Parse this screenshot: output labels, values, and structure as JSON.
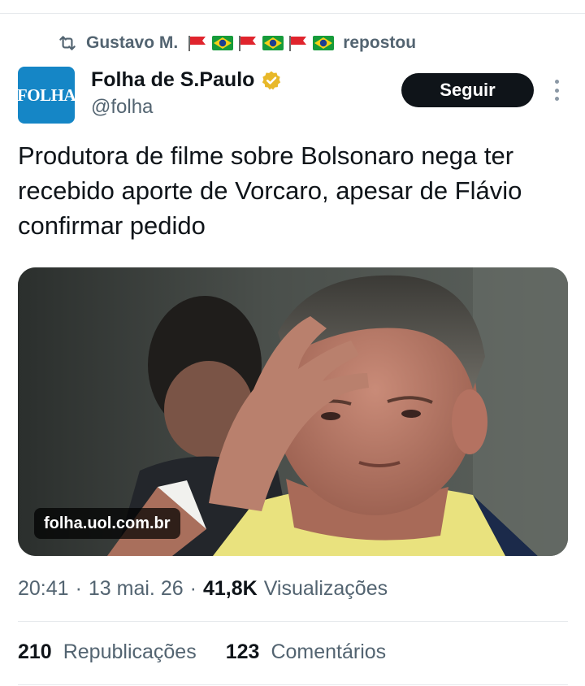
{
  "repost": {
    "icon": "repost-icon",
    "user_name": "Gustavo M.",
    "flags": [
      "red-flag",
      "brazil-flag",
      "red-flag",
      "brazil-flag",
      "red-flag",
      "brazil-flag"
    ],
    "suffix": "repostou"
  },
  "author": {
    "avatar_text": "FOLHA",
    "avatar_color": "#1586c6",
    "name": "Folha de S.Paulo",
    "verified_icon": "verified-gold-badge-icon",
    "verified_color": "#e8b829",
    "handle": "@folha"
  },
  "actions": {
    "follow_label": "Seguir",
    "more_icon": "more-vertical-icon"
  },
  "tweet": {
    "text": "Produtora de filme sobre Bolsonaro nega ter recebido aporte de Vorcaro, apesar de Flávio confirmar pedido"
  },
  "media": {
    "domain": "folha.uol.com.br"
  },
  "meta": {
    "time": "20:41",
    "date": "13 mai. 26",
    "views_count": "41,8K",
    "views_label": "Visualizações"
  },
  "stats": {
    "reposts_count": "210",
    "reposts_label": "Republicações",
    "comments_count": "123",
    "comments_label": "Comentários"
  },
  "colors": {
    "text_primary": "#0f1419",
    "text_secondary": "#536471",
    "follow_bg": "#0f1419"
  }
}
